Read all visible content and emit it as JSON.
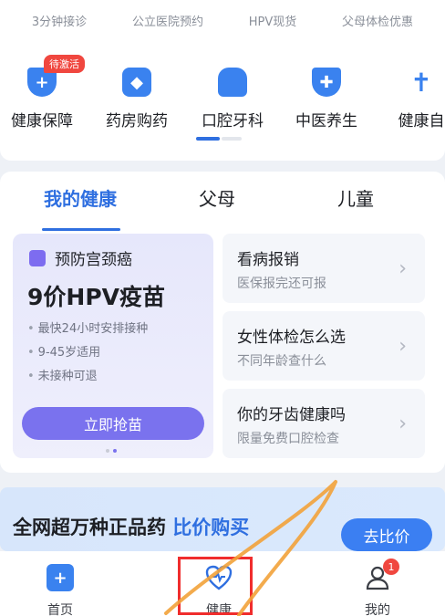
{
  "top_links": [
    "3分钟接诊",
    "公立医院预约",
    "HPV现货",
    "父母体检优惠"
  ],
  "services": [
    {
      "label": "健康保障",
      "icon": "shield-plus-icon",
      "badge": "待激活",
      "color": "#3a82ef"
    },
    {
      "label": "药房购药",
      "icon": "medicine-box-icon",
      "color": "#3a82ef"
    },
    {
      "label": "口腔牙科",
      "icon": "tooth-icon",
      "color": "#3a82ef"
    },
    {
      "label": "中医养生",
      "icon": "herb-bowl-icon",
      "color": "#3a82ef"
    },
    {
      "label": "健康自",
      "icon": "person-icon",
      "color": "#3a82ef"
    }
  ],
  "health": {
    "tabs": [
      "我的健康",
      "父母",
      "儿童"
    ],
    "active_tab": "我的健康",
    "promo": {
      "header": "预防宫颈癌",
      "title": "9价HPV疫苗",
      "bullets": [
        "最快24小时安排接种",
        "9-45岁适用",
        "未接种可退"
      ],
      "button": "立即抢苗"
    },
    "cards": [
      {
        "title": "看病报销",
        "subtitle": "医保报完还可报"
      },
      {
        "title": "女性体检怎么选",
        "subtitle": "不同年龄查什么"
      },
      {
        "title": "你的牙齿健康吗",
        "subtitle": "限量免费口腔检查"
      }
    ]
  },
  "banner": {
    "text_main": "全网超万种正品药",
    "text_highlight": "比价购买",
    "button": "去比价"
  },
  "nav": [
    {
      "label": "首页",
      "icon": "home-plus-icon"
    },
    {
      "label": "健康",
      "icon": "heart-pulse-icon"
    },
    {
      "label": "我的",
      "icon": "user-icon",
      "badge": "1"
    }
  ],
  "colors": {
    "accent": "#2f6fe0",
    "promo_button": "#7a72ee",
    "annotation": "#f02d2d",
    "stroke": "#f2a23a"
  }
}
